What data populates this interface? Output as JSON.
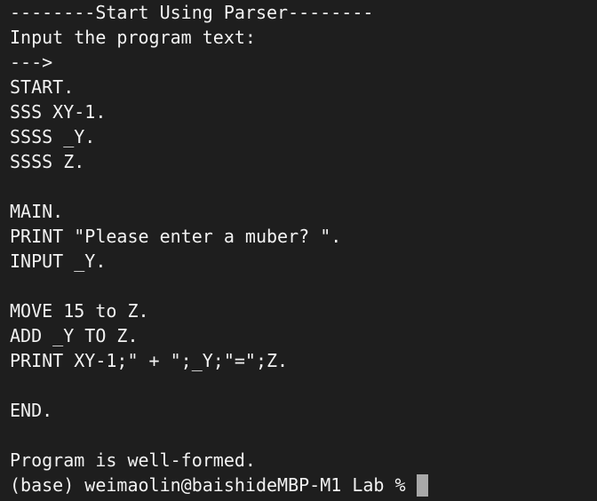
{
  "terminal": {
    "lines": [
      "--------Start Using Parser--------",
      "Input the program text:",
      "--->",
      "START.",
      "SSS XY-1.",
      "SSSS _Y.",
      "SSSS Z.",
      "",
      "MAIN.",
      "PRINT \"Please enter a muber? \".",
      "INPUT _Y.",
      "",
      "MOVE 15 to Z.",
      "ADD _Y TO Z.",
      "PRINT XY-1;\" + \";_Y;\"=\";Z.",
      "",
      "END.",
      "",
      "Program is well-formed."
    ],
    "prompt": "(base) weimaolin@baishideMBP-M1 Lab %"
  }
}
